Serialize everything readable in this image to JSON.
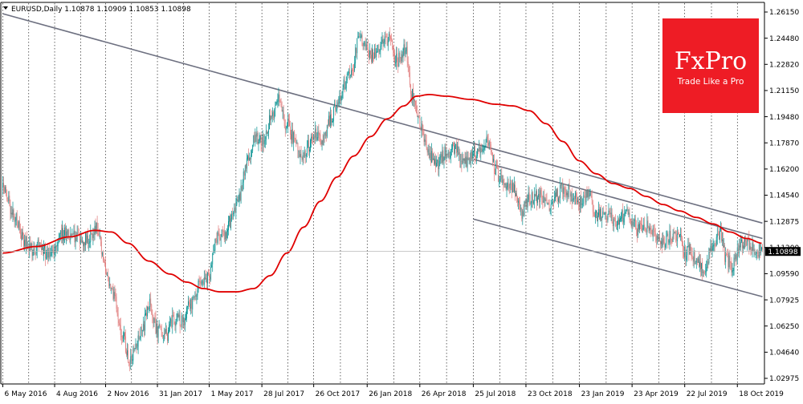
{
  "header": {
    "symbol_line": "EURUSD,Daily  1.10878 1.10909 1.10853 1.10898"
  },
  "logo": {
    "brand": "FxPro",
    "tagline": "Trade Like a Pro",
    "bg_color": "#ee1c25",
    "text_color": "#ffffff"
  },
  "colors": {
    "bull": "#008f8f",
    "bear": "#e07a7a",
    "ma": "#e00000",
    "channel": "#6d7080",
    "grid": "#000000",
    "axis": "#000000"
  },
  "chart_data": {
    "type": "candlestick",
    "symbol": "EURUSD",
    "timeframe": "Daily",
    "last_price": "1.10898",
    "ylim": [
      1.0275,
      1.2625
    ],
    "y_ticks": [
      "1.26150",
      "1.24480",
      "1.22820",
      "1.21150",
      "1.19480",
      "1.17870",
      "1.16200",
      "1.14540",
      "1.12875",
      "1.11200",
      "1.09590",
      "1.07925",
      "1.06250",
      "1.04640",
      "1.02975"
    ],
    "x_ticks": [
      "6 May 2016",
      "4 Aug 2016",
      "2 Nov 2016",
      "31 Jan 2017",
      "1 May 2017",
      "28 Jul 2017",
      "26 Oct 2017",
      "26 Jan 2018",
      "26 Apr 2018",
      "25 Jul 2018",
      "23 Oct 2018",
      "23 Jan 2019",
      "23 Apr 2019",
      "22 Jul 2019",
      "18 Oct 2019"
    ],
    "x_ticks_idx": [
      0,
      62,
      123,
      185,
      247,
      310,
      372,
      436,
      499,
      563,
      626,
      690,
      753,
      816,
      879
    ],
    "n_bars": 910,
    "path_anchors": [
      [
        0,
        1.148
      ],
      [
        15,
        1.13
      ],
      [
        25,
        1.116
      ],
      [
        35,
        1.11
      ],
      [
        45,
        1.113
      ],
      [
        55,
        1.106
      ],
      [
        70,
        1.12
      ],
      [
        85,
        1.118
      ],
      [
        100,
        1.116
      ],
      [
        112,
        1.123
      ],
      [
        123,
        1.098
      ],
      [
        133,
        1.08
      ],
      [
        143,
        1.058
      ],
      [
        152,
        1.04
      ],
      [
        158,
        1.048
      ],
      [
        167,
        1.062
      ],
      [
        175,
        1.076
      ],
      [
        185,
        1.06
      ],
      [
        195,
        1.057
      ],
      [
        205,
        1.067
      ],
      [
        215,
        1.066
      ],
      [
        225,
        1.076
      ],
      [
        235,
        1.088
      ],
      [
        247,
        1.092
      ],
      [
        255,
        1.117
      ],
      [
        265,
        1.119
      ],
      [
        272,
        1.128
      ],
      [
        282,
        1.141
      ],
      [
        292,
        1.164
      ],
      [
        302,
        1.178
      ],
      [
        312,
        1.179
      ],
      [
        322,
        1.192
      ],
      [
        330,
        1.202
      ],
      [
        340,
        1.187
      ],
      [
        350,
        1.178
      ],
      [
        358,
        1.168
      ],
      [
        366,
        1.174
      ],
      [
        372,
        1.182
      ],
      [
        382,
        1.178
      ],
      [
        392,
        1.19
      ],
      [
        400,
        1.201
      ],
      [
        410,
        1.214
      ],
      [
        418,
        1.222
      ],
      [
        426,
        1.242
      ],
      [
        434,
        1.234
      ],
      [
        442,
        1.23
      ],
      [
        452,
        1.237
      ],
      [
        462,
        1.24
      ],
      [
        472,
        1.227
      ],
      [
        482,
        1.234
      ],
      [
        490,
        1.206
      ],
      [
        500,
        1.186
      ],
      [
        510,
        1.168
      ],
      [
        520,
        1.163
      ],
      [
        530,
        1.17
      ],
      [
        540,
        1.172
      ],
      [
        553,
        1.163
      ],
      [
        563,
        1.17
      ],
      [
        571,
        1.172
      ],
      [
        580,
        1.178
      ],
      [
        590,
        1.158
      ],
      [
        600,
        1.152
      ],
      [
        610,
        1.148
      ],
      [
        620,
        1.133
      ],
      [
        630,
        1.142
      ],
      [
        643,
        1.143
      ],
      [
        652,
        1.137
      ],
      [
        662,
        1.144
      ],
      [
        672,
        1.148
      ],
      [
        682,
        1.143
      ],
      [
        690,
        1.14
      ],
      [
        700,
        1.144
      ],
      [
        710,
        1.131
      ],
      [
        722,
        1.132
      ],
      [
        735,
        1.126
      ],
      [
        748,
        1.135
      ],
      [
        753,
        1.127
      ],
      [
        760,
        1.122
      ],
      [
        770,
        1.124
      ],
      [
        778,
        1.12
      ],
      [
        788,
        1.114
      ],
      [
        800,
        1.118
      ],
      [
        810,
        1.12
      ],
      [
        816,
        1.108
      ],
      [
        823,
        1.11
      ],
      [
        830,
        1.102
      ],
      [
        840,
        1.098
      ],
      [
        848,
        1.113
      ],
      [
        858,
        1.12
      ],
      [
        866,
        1.104
      ],
      [
        872,
        1.1
      ],
      [
        882,
        1.112
      ],
      [
        893,
        1.114
      ],
      [
        899,
        1.111
      ],
      [
        909,
        1.109
      ]
    ],
    "ma_anchors": [
      [
        0,
        1.108
      ],
      [
        40,
        1.112
      ],
      [
        80,
        1.118
      ],
      [
        110,
        1.122
      ],
      [
        130,
        1.121
      ],
      [
        150,
        1.114
      ],
      [
        175,
        1.103
      ],
      [
        200,
        1.095
      ],
      [
        220,
        1.09
      ],
      [
        240,
        1.086
      ],
      [
        260,
        1.084
      ],
      [
        280,
        1.084
      ],
      [
        300,
        1.086
      ],
      [
        320,
        1.094
      ],
      [
        340,
        1.108
      ],
      [
        360,
        1.124
      ],
      [
        380,
        1.14
      ],
      [
        400,
        1.155
      ],
      [
        420,
        1.168
      ],
      [
        440,
        1.18
      ],
      [
        460,
        1.191
      ],
      [
        480,
        1.199
      ],
      [
        495,
        1.205
      ],
      [
        510,
        1.206
      ],
      [
        530,
        1.205
      ],
      [
        560,
        1.203
      ],
      [
        590,
        1.2
      ],
      [
        610,
        1.199
      ],
      [
        630,
        1.196
      ],
      [
        650,
        1.188
      ],
      [
        670,
        1.177
      ],
      [
        690,
        1.165
      ],
      [
        710,
        1.157
      ],
      [
        730,
        1.151
      ],
      [
        750,
        1.148
      ],
      [
        770,
        1.143
      ],
      [
        790,
        1.138
      ],
      [
        810,
        1.134
      ],
      [
        830,
        1.13
      ],
      [
        850,
        1.126
      ],
      [
        870,
        1.121
      ],
      [
        890,
        1.117
      ],
      [
        909,
        1.114
      ]
    ],
    "channel_lines": [
      {
        "x1": 0,
        "y1": 1.256,
        "x2": 909,
        "y2": 1.1265
      },
      {
        "x1": 563,
        "y1": 1.129,
        "x2": 909,
        "y2": 1.081
      },
      {
        "x1": 563,
        "y1": 1.166,
        "x2": 909,
        "y2": 1.117
      }
    ],
    "xlabel": "",
    "ylabel": "",
    "grid": "vertical dotted"
  }
}
